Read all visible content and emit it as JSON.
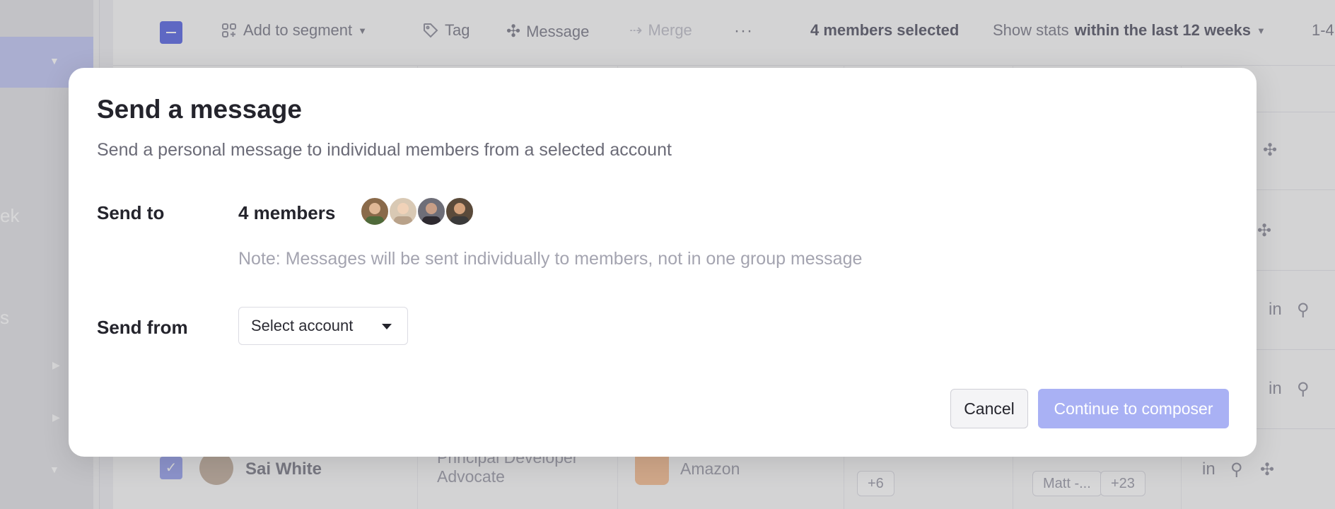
{
  "toolbar": {
    "add_to_segment": "Add to segment",
    "tag": "Tag",
    "message": "Message",
    "merge": "Merge",
    "selected_count": "4 members selected",
    "stats_prefix": "Show stats",
    "stats_range": "within the last 12 weeks",
    "pagination": "1-4"
  },
  "sidebar": {
    "partial_text_1": "ek",
    "partial_text_2": "s"
  },
  "background_row": {
    "name": "Sai White",
    "title": "Principal Developer Advocate",
    "company": "Amazon",
    "chip_more": "+6",
    "chip_owner": "Matt - Customers",
    "chip_owner2": "Matt -...",
    "chip_more2": "+23"
  },
  "modal": {
    "title": "Send a message",
    "subtitle": "Send a personal message to individual members from a selected account",
    "send_to_label": "Send to",
    "members_count": "4 members",
    "note": "Note: Messages will be sent individually to members, not in one group message",
    "send_from_label": "Send from",
    "select_placeholder": "Select account",
    "cancel_label": "Cancel",
    "continue_label": "Continue to composer"
  },
  "colors": {
    "accent": "#6c78e6",
    "primary_button_disabled": "#a9b1f4",
    "sidebar_active": "#c8cdf6"
  }
}
